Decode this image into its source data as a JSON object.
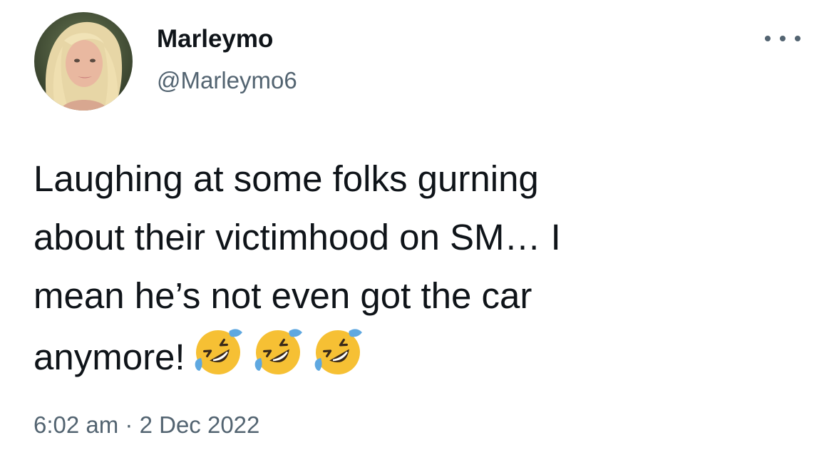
{
  "user": {
    "display_name": "Marleymo",
    "handle": "@Marleymo6"
  },
  "tweet": {
    "lines": [
      "Laughing at some folks gurning",
      "about their victimhood on SM… I",
      "mean he’s not even got the car",
      "anymore!"
    ],
    "emojis": [
      "rolling-on-floor-laughing",
      "rolling-on-floor-laughing",
      "rolling-on-floor-laughing"
    ],
    "time": "6:02 am",
    "separator": "·",
    "date": "2 Dec 2022"
  },
  "icons": {
    "more": "more-horizontal-icon"
  },
  "colors": {
    "text_primary": "#0f1419",
    "text_secondary": "#536471",
    "emoji_face": "#f6c034",
    "emoji_tear": "#5fa8e0"
  }
}
